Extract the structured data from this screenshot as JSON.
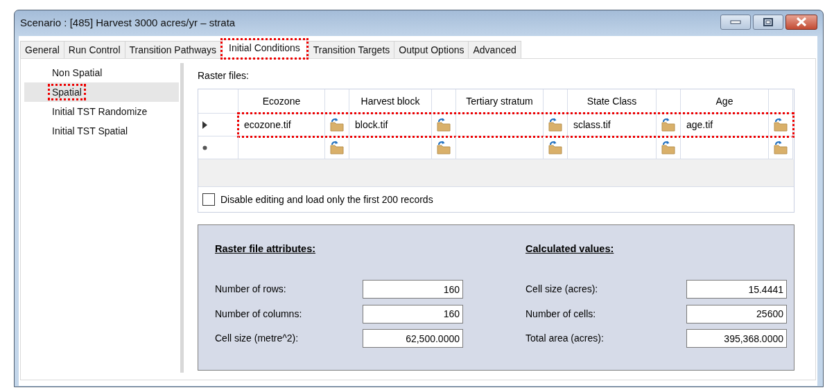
{
  "window": {
    "title": "Scenario : [485] Harvest 3000 acres/yr – strata"
  },
  "tabs": [
    {
      "label": "General",
      "selected": false,
      "highlighted": false
    },
    {
      "label": "Run Control",
      "selected": false,
      "highlighted": false
    },
    {
      "label": "Transition Pathways",
      "selected": false,
      "highlighted": false
    },
    {
      "label": "Initial Conditions",
      "selected": true,
      "highlighted": true
    },
    {
      "label": "Transition Targets",
      "selected": false,
      "highlighted": false
    },
    {
      "label": "Output Options",
      "selected": false,
      "highlighted": false
    },
    {
      "label": "Advanced",
      "selected": false,
      "highlighted": false
    }
  ],
  "sidebar": {
    "items": [
      {
        "label": "Non Spatial",
        "selected": false,
        "highlighted": false
      },
      {
        "label": "Spatial",
        "selected": true,
        "highlighted": true
      },
      {
        "label": "Initial TST Randomize",
        "selected": false,
        "highlighted": false
      },
      {
        "label": "Initial TST Spatial",
        "selected": false,
        "highlighted": false
      }
    ]
  },
  "raster_files": {
    "label": "Raster files:",
    "columns": [
      "Ecozone",
      "Harvest block",
      "Tertiary stratum",
      "State Class",
      "Age"
    ],
    "rows": [
      {
        "kind": "current",
        "highlighted": true,
        "cells": [
          {
            "value": "ecozone.tif"
          },
          {
            "value": "block.tif"
          },
          {},
          {
            "value": "sclass.tif"
          },
          {
            "value": "age.tif"
          }
        ]
      },
      {
        "kind": "new",
        "highlighted": false,
        "cells": [
          {},
          {},
          {},
          {},
          {}
        ]
      }
    ],
    "checkbox": {
      "label": "Disable editing and load only the first 200 records",
      "checked": false
    }
  },
  "attributes": [
    {
      "title": "Raster file attributes:",
      "fields": [
        {
          "label": "Number of rows:",
          "value": "160"
        },
        {
          "label": "Number of columns:",
          "value": "160"
        },
        {
          "label": "Cell size (metre^2):",
          "value": "62,500.0000"
        }
      ]
    },
    {
      "title": "Calculated values:",
      "fields": [
        {
          "label": "Cell size (acres):",
          "value": "15.4441"
        },
        {
          "label": "Number of cells:",
          "value": "25600"
        },
        {
          "label": "Total area (acres):",
          "value": "395,368.0000"
        }
      ]
    }
  ]
}
